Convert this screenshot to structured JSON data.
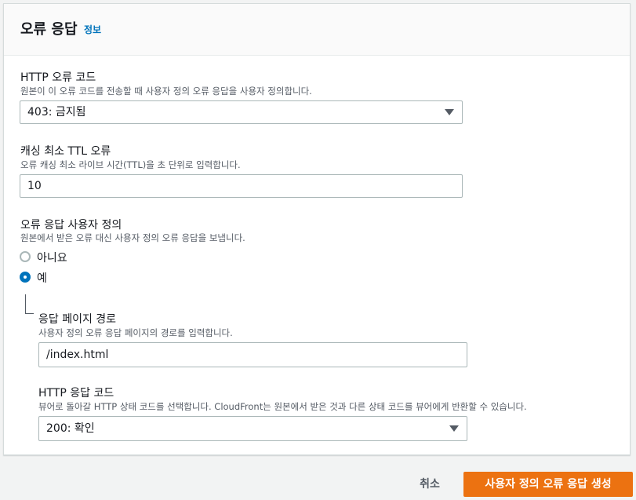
{
  "panel": {
    "title": "오류 응답",
    "info_link": "정보"
  },
  "http_error_code": {
    "label": "HTTP 오류 코드",
    "description": "원본이 이 오류 코드를 전송할 때 사용자 정의 오류 응답을 사용자 정의합니다.",
    "selected": "403: 금지됨"
  },
  "min_ttl": {
    "label": "캐싱 최소 TTL 오류",
    "description": "오류 캐싱 최소 라이브 시간(TTL)을 초 단위로 입력합니다.",
    "value": "10"
  },
  "custom_response": {
    "label": "오류 응답 사용자 정의",
    "description": "원본에서 받은 오류 대신 사용자 정의 오류 응답을 보냅니다.",
    "options": [
      {
        "label": "아니요",
        "selected": false
      },
      {
        "label": "예",
        "selected": true
      }
    ]
  },
  "response_page_path": {
    "label": "응답 페이지 경로",
    "description": "사용자 정의 오류 응답 페이지의 경로를 입력합니다.",
    "value": "/index.html"
  },
  "http_response_code": {
    "label": "HTTP 응답 코드",
    "description": "뷰어로 돌아갈 HTTP 상태 코드를 선택합니다. CloudFront는 원본에서 받은 것과 다른 상태 코드를 뷰어에게 반환할 수 있습니다.",
    "selected": "200: 확인"
  },
  "footer": {
    "cancel_label": "취소",
    "submit_label": "사용자 정의 오류 응답 생성"
  },
  "colors": {
    "primary": "#ec7211",
    "link": "#0073bb",
    "radio_selected": "#0073bb"
  }
}
